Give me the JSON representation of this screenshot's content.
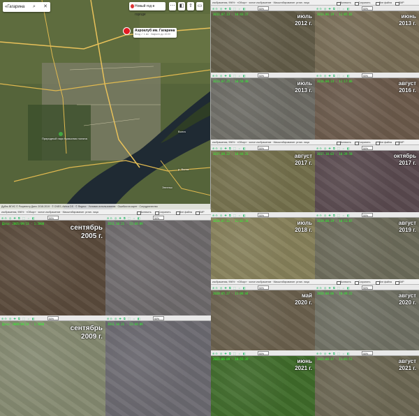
{
  "map": {
    "search_value": "«Гагарина",
    "new_year_button": "Новый год в городе",
    "poi_title": "Аэроклуб им. Гагарина",
    "poi_subtitle": "Вход ✓ 1 км · Закрыто до 10:00",
    "park_label": "Природный парк\nКумысная поляна",
    "river_label_1": "Волга",
    "river_label_2": "р. Волга",
    "district_label": "Энгельс",
    "copyright": "Дубль ВГИС © Росреестр Дата: 2018-2019 · © CNES, Airbus DS · © Яндекс · Условия использования · Ошибка на карте · Сотрудничество",
    "tools": [
      "menu-icon",
      "layers-icon",
      "share-icon",
      "ruler-icon"
    ]
  },
  "viewer_title": "изображения, 996% · «Обзор» · ясное изображение · Масштабирование: устан. лица",
  "checkboxes": [
    "Включить",
    "Сохранить",
    "Вне файла",
    "БМР"
  ],
  "toolbar_icons": "⊕⊖ ◎ ✚ ⧉ ⬚ ⇔ ◧",
  "zoom": "50%",
  "left_group": [
    {
      "month": "сентябрь",
      "year": "2005 г.",
      "stamp": "Дата: 2005/09/13 · 1:5000",
      "base": "#5b4b3c",
      "grid": "#6b5a48"
    },
    {
      "month": "",
      "year": "",
      "stamp": "2011.10.21 · 23:44:09",
      "base": "#6e6a6c",
      "grid": "#7c7778"
    },
    {
      "month": "сентябрь",
      "year": "2009 г.",
      "stamp": "Дата: 2009/09/24 · 1:5000",
      "base": "#858a71",
      "grid": "#959a80"
    },
    {
      "month": "",
      "year": "",
      "stamp": "2011.10.21 · 23:44:09",
      "base": "#6c6a71",
      "grid": "#7a7880"
    }
  ],
  "right_group": [
    {
      "month": "июль",
      "year": "2012 г.",
      "stamp": "2012.07.13 · 10:43:17",
      "base": "#625c48"
    },
    {
      "month": "июнь",
      "year": "2013 г.",
      "stamp": "2013.06.19 · 11:05:02",
      "base": "#786d56"
    },
    {
      "month": "июль",
      "year": "2013 г.",
      "stamp": "2013.07.25 · 10:58:40",
      "base": "#6d6c65"
    },
    {
      "month": "август",
      "year": "2016 г.",
      "stamp": "2016.08.14 · 11:17:06",
      "base": "#6b5a4b"
    },
    {
      "month": "август",
      "year": "2017 г.",
      "stamp": "2017.08.22 · 10:44:31",
      "base": "#74704c"
    },
    {
      "month": "октябрь",
      "year": "2017 г.",
      "stamp": "2017.10.03 · 10:39:58",
      "base": "#5a4a4f"
    },
    {
      "month": "июль",
      "year": "2018 г.",
      "stamp": "2018.07.11 · 11:02:14",
      "base": "#86805a"
    },
    {
      "month": "август",
      "year": "2019 г.",
      "stamp": "2019.08.19 · 10:51:07",
      "base": "#6c6b5a"
    },
    {
      "month": "май",
      "year": "2020 г.",
      "stamp": "2020.05.27 · 11:08:44",
      "base": "#6a604d"
    },
    {
      "month": "август",
      "year": "2020 г.",
      "stamp": "2020.08.06 · 10:49:22",
      "base": "#707164"
    },
    {
      "month": "июнь",
      "year": "2021 г.",
      "stamp": "2021.06.09 · 10:55:39",
      "base": "#3f6b2a"
    },
    {
      "month": "август",
      "year": "2021 г.",
      "stamp": "2021.08.17 · 11:01:51",
      "base": "#6c6753"
    }
  ]
}
